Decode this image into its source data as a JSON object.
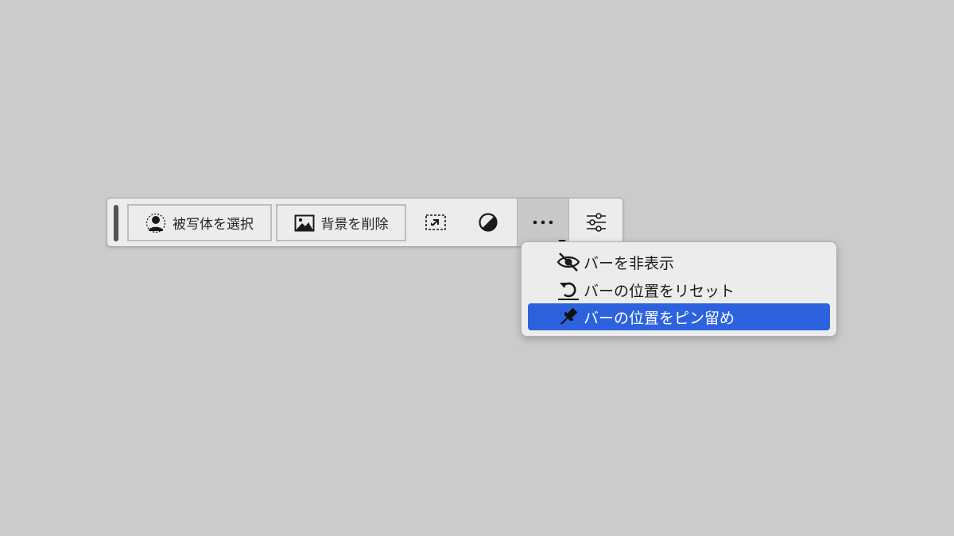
{
  "toolbar": {
    "select_subject_label": "被写体を選択",
    "remove_background_label": "背景を削除",
    "icons": {
      "select_subject": "person-selection-icon",
      "remove_background": "image-icon",
      "transform": "transform-selection-icon",
      "adjustment": "half-circle-contrast-icon",
      "more": "ellipsis-icon",
      "settings": "sliders-icon"
    }
  },
  "menu": {
    "items": [
      {
        "label": "バーを非表示",
        "icon": "eye-slash-icon"
      },
      {
        "label": "バーの位置をリセット",
        "icon": "reset-icon"
      },
      {
        "label": "バーの位置をピン留め",
        "icon": "pin-icon",
        "highlighted": true
      }
    ]
  },
  "colors": {
    "background": "#cbcbcb",
    "toolbar": "#ececec",
    "highlight": "#2d62de"
  }
}
